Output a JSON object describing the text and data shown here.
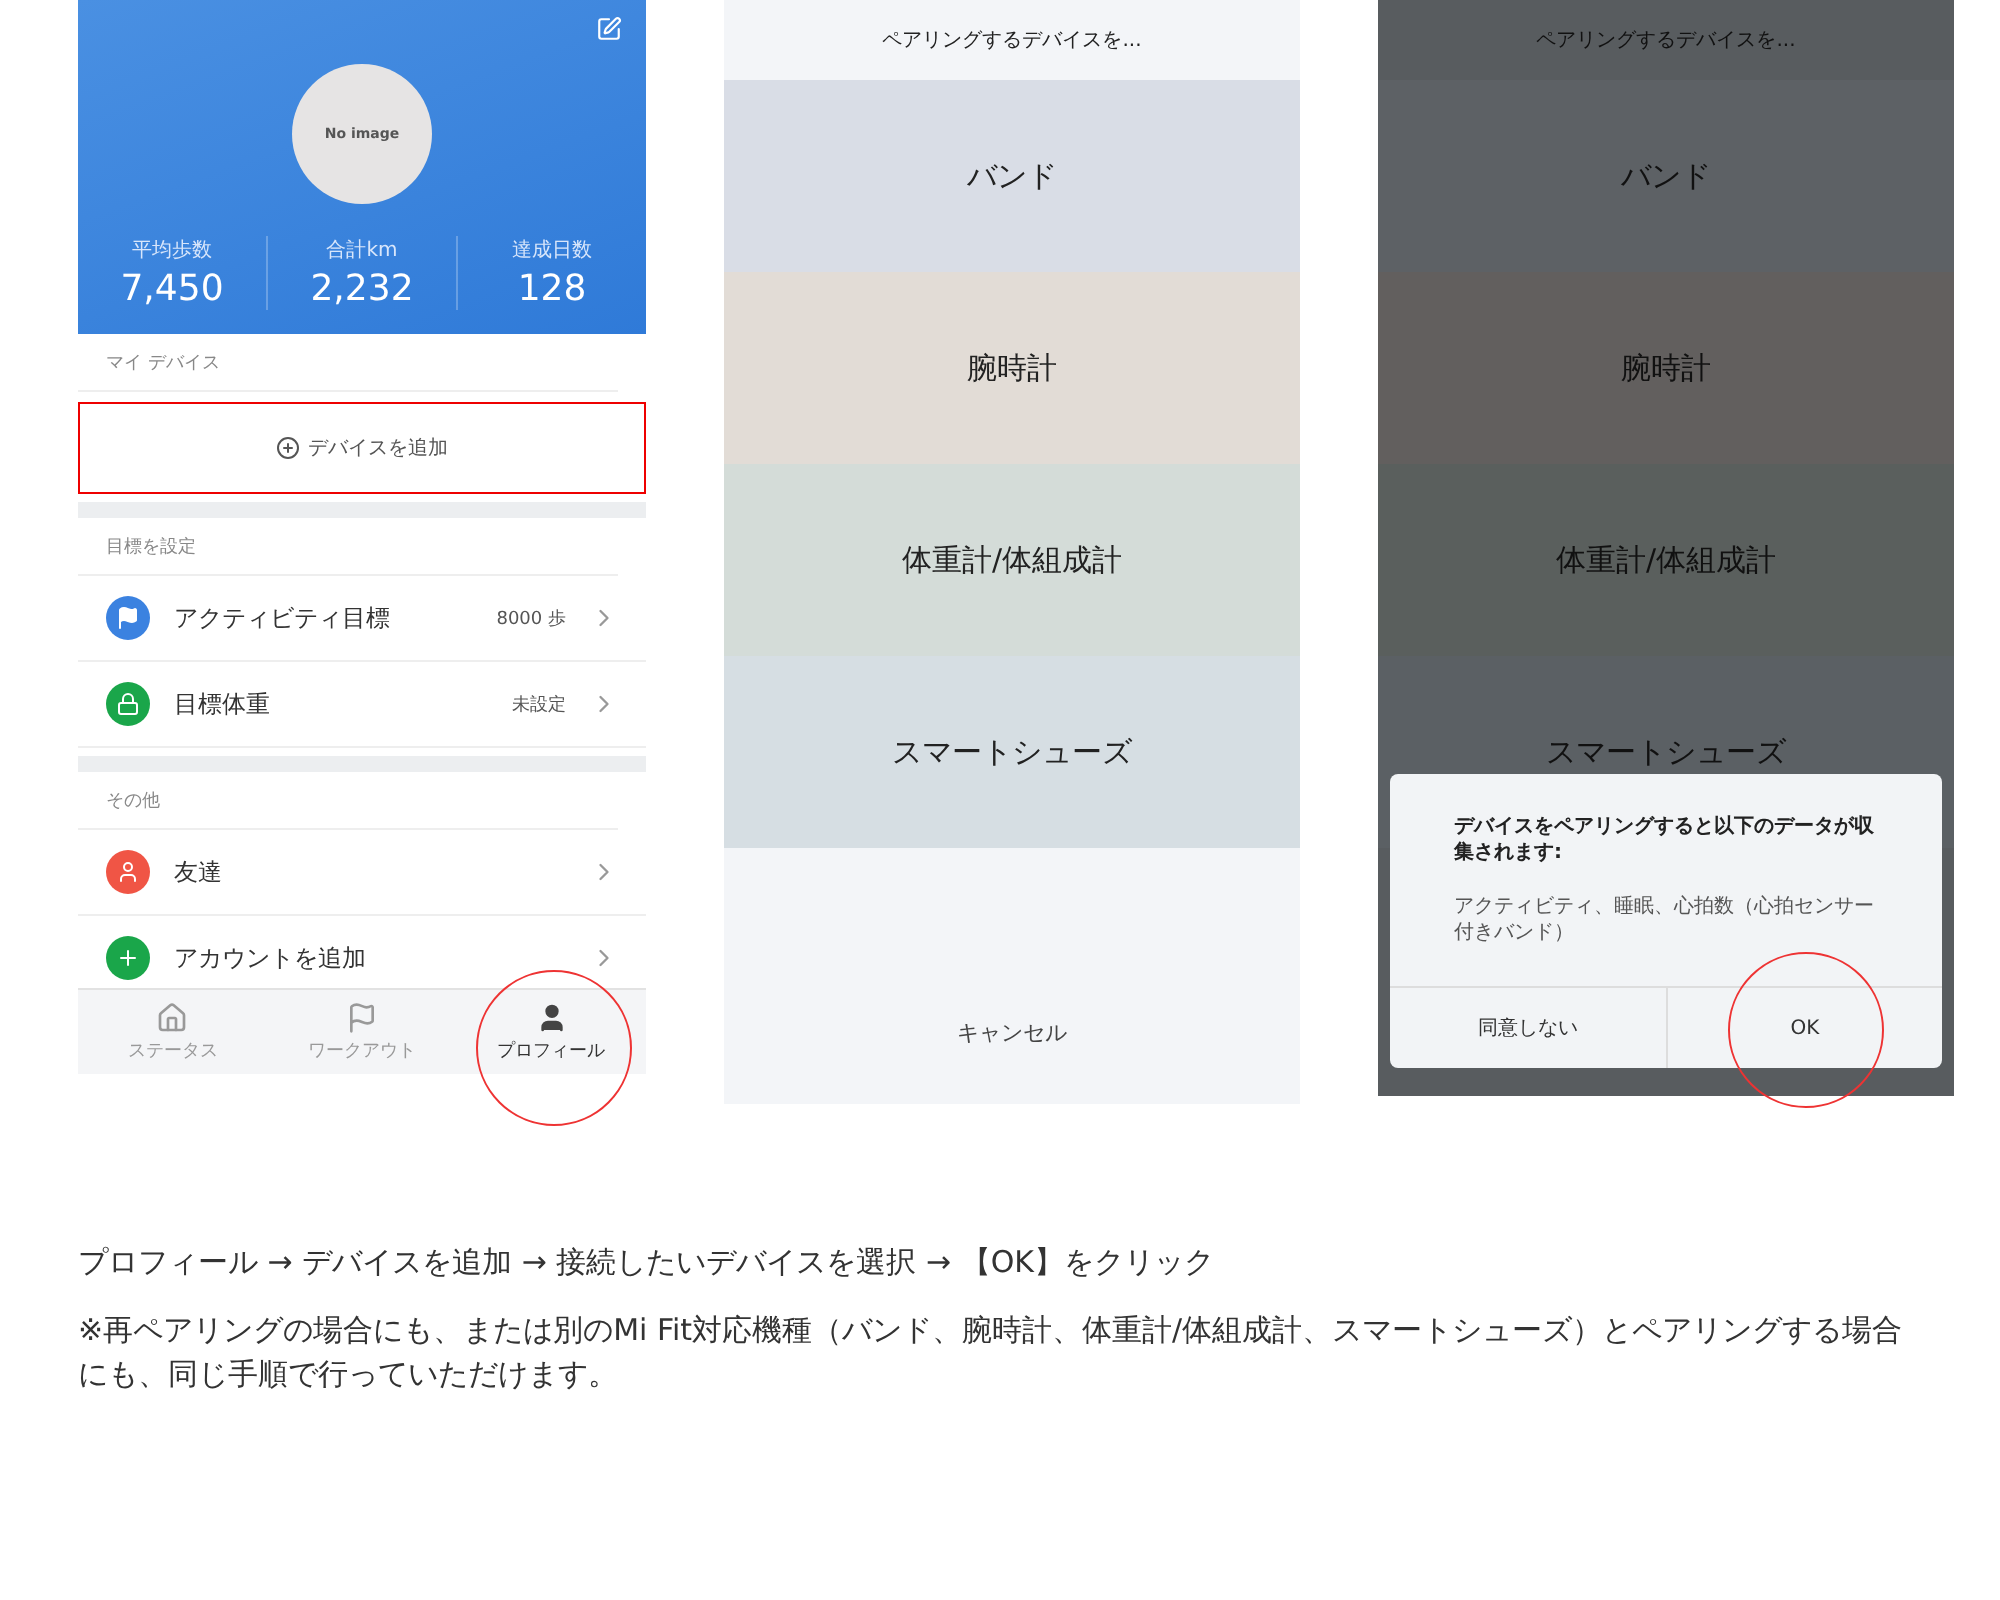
{
  "profile_screen": {
    "avatar_label": "No image",
    "stats": [
      {
        "label": "平均歩数",
        "value": "7,450"
      },
      {
        "label": "合計km",
        "value": "2,232"
      },
      {
        "label": "達成日数",
        "value": "128"
      }
    ],
    "my_devices": {
      "title": "マイ デバイス",
      "add_button": {
        "label": "デバイスを追加",
        "highlighted": true
      }
    },
    "sections": [
      {
        "title": "目標を設定",
        "rows": [
          {
            "kind": "flag",
            "label": "アクティビティ目標",
            "value": "8000 歩"
          },
          {
            "kind": "lock",
            "label": "目標体重",
            "value": "未設定"
          }
        ]
      },
      {
        "title": "その他",
        "rows": [
          {
            "kind": "person",
            "label": "友達"
          },
          {
            "kind": "plus",
            "label": "アカウントを追加"
          }
        ]
      }
    ],
    "tabs": [
      {
        "kind": "home",
        "label": "ステータス",
        "selected": false,
        "highlighted": false
      },
      {
        "kind": "flag",
        "label": "ワークアウト",
        "selected": false,
        "highlighted": false
      },
      {
        "kind": "person",
        "label": "プロフィール",
        "selected": true,
        "highlighted": true
      }
    ]
  },
  "device_picker": {
    "title": "ペアリングするデバイスを...",
    "options": [
      "バンド",
      "腕時計",
      "体重計/体組成計",
      "スマートシューズ"
    ],
    "cancel": "キャンセル"
  },
  "consent_screen": {
    "title": "ペアリングするデバイスを...",
    "options": [
      "バンド",
      "腕時計",
      "体重計/体組成計",
      "スマートシューズ"
    ],
    "dialog": {
      "title": "デバイスをペアリングすると以下のデータが収集されます:",
      "body": "アクティビティ、睡眠、心拍数（心拍センサー付きバンド）",
      "buttons": [
        {
          "label": "同意しない",
          "highlighted": false
        },
        {
          "label": "OK",
          "highlighted": true
        }
      ]
    }
  },
  "caption": "プロフィール → デバイスを追加 → 接続したいデバイスを選択 → 【OK】をクリック",
  "note": "※再ペアリングの場合にも、または別のMi Fit対応機種（バンド、腕時計、体重計/体組成計、スマートシューズ）とペアリングする場合にも、同じ手順で行っていただけます。"
}
